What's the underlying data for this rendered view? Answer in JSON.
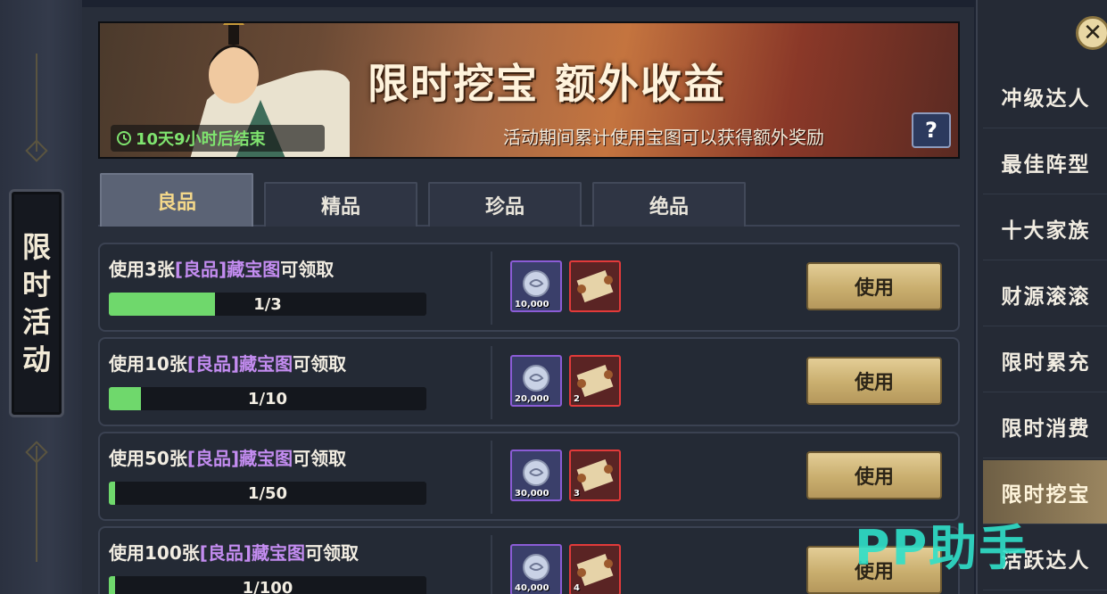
{
  "side_title": [
    "限",
    "时",
    "活",
    "动"
  ],
  "banner": {
    "title": "限时挖宝 额外收益",
    "timer": "10天9小时后结束",
    "description": "活动期间累计使用宝图可以获得额外奖励",
    "help": "?"
  },
  "tabs": [
    {
      "label": "良品",
      "active": true
    },
    {
      "label": "精品",
      "active": false
    },
    {
      "label": "珍品",
      "active": false
    },
    {
      "label": "绝品",
      "active": false
    }
  ],
  "tasks": [
    {
      "prefix": "使用3张",
      "item": "[良品]藏宝图",
      "suffix": "可领取",
      "progress_text": "1/3",
      "progress": 0.333,
      "rewards": [
        {
          "icon": "silver-coin-icon",
          "amount": "10,000"
        },
        {
          "icon": "treasure-map-scroll-icon",
          "amount": ""
        }
      ],
      "button": "使用"
    },
    {
      "prefix": "使用10张",
      "item": "[良品]藏宝图",
      "suffix": "可领取",
      "progress_text": "1/10",
      "progress": 0.1,
      "rewards": [
        {
          "icon": "silver-coin-icon",
          "amount": "20,000"
        },
        {
          "icon": "treasure-map-scroll-icon",
          "amount": "2"
        }
      ],
      "button": "使用"
    },
    {
      "prefix": "使用50张",
      "item": "[良品]藏宝图",
      "suffix": "可领取",
      "progress_text": "1/50",
      "progress": 0.02,
      "rewards": [
        {
          "icon": "silver-coin-icon",
          "amount": "30,000"
        },
        {
          "icon": "treasure-map-scroll-icon",
          "amount": "3"
        }
      ],
      "button": "使用"
    },
    {
      "prefix": "使用100张",
      "item": "[良品]藏宝图",
      "suffix": "可领取",
      "progress_text": "1/100",
      "progress": 0.01,
      "rewards": [
        {
          "icon": "silver-coin-icon",
          "amount": "40,000"
        },
        {
          "icon": "treasure-map-scroll-icon",
          "amount": "4"
        }
      ],
      "button": "使用"
    }
  ],
  "nav": [
    {
      "label": "冲级达人",
      "active": false
    },
    {
      "label": "最佳阵型",
      "active": false
    },
    {
      "label": "十大家族",
      "active": false
    },
    {
      "label": "财源滚滚",
      "active": false
    },
    {
      "label": "限时累充",
      "active": false
    },
    {
      "label": "限时消费",
      "active": false
    },
    {
      "label": "限时挖宝",
      "active": true
    },
    {
      "label": "活跃达人",
      "active": false
    }
  ],
  "close": "✕",
  "watermark": "PP助手",
  "colors": {
    "progress_fill": "#6fd86c",
    "highlight_item": "#c38cf0",
    "tab_active_text": "#f4d88a",
    "timer_text": "#7fe46f"
  }
}
